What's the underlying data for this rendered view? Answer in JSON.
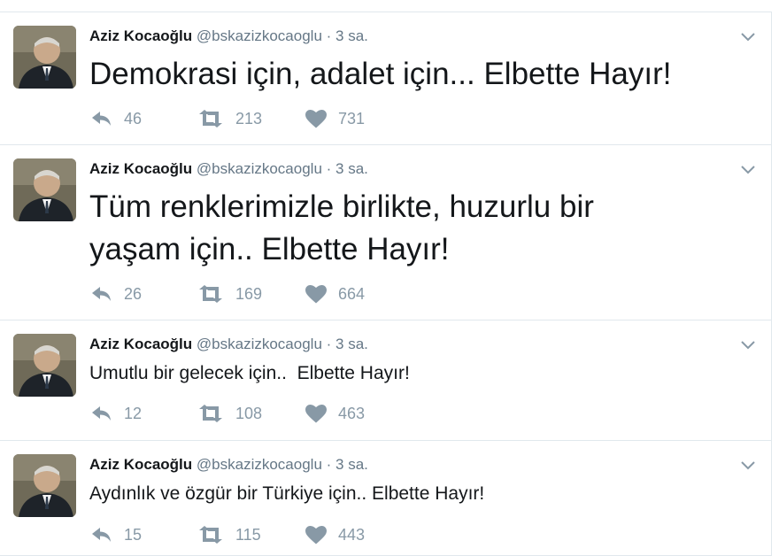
{
  "colors": {
    "name": "#14171a",
    "meta": "#657786",
    "icon": "#8899a6",
    "divider": "#e1e8ed"
  },
  "icons": {
    "reply": "reply-icon",
    "retweet": "retweet-icon",
    "like": "heart-icon",
    "menu": "chevron-down-icon"
  },
  "tweets": [
    {
      "name": "Aziz Kocaoğlu",
      "handle": "@bskazizkocaoglu",
      "separator": "·",
      "time": "3 sa.",
      "lines": [
        "Demokrasi için, adalet için... Elbette Hayır!"
      ],
      "replies": "46",
      "retweets": "213",
      "likes": "731"
    },
    {
      "name": "Aziz Kocaoğlu",
      "handle": "@bskazizkocaoglu",
      "separator": "·",
      "time": "3 sa.",
      "lines": [
        "Tüm renklerimizle birlikte, huzurlu bir",
        "yaşam için.. Elbette Hayır!"
      ],
      "replies": "26",
      "retweets": "169",
      "likes": "664"
    },
    {
      "name": "Aziz Kocaoğlu",
      "handle": "@bskazizkocaoglu",
      "separator": "·",
      "time": "3 sa.",
      "lines": [
        "Umutlu bir gelecek için..  Elbette Hayır!"
      ],
      "replies": "12",
      "retweets": "108",
      "likes": "463"
    },
    {
      "name": "Aziz Kocaoğlu",
      "handle": "@bskazizkocaoglu",
      "separator": "·",
      "time": "3 sa.",
      "lines": [
        "Aydınlık ve özgür bir Türkiye için.. Elbette Hayır!"
      ],
      "replies": "15",
      "retweets": "115",
      "likes": "443"
    }
  ]
}
